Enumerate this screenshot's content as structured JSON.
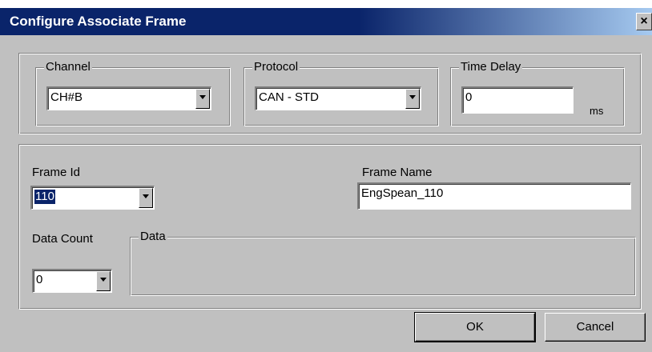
{
  "window": {
    "title": "Configure Associate Frame",
    "close_glyph": "×"
  },
  "channel": {
    "legend": "Channel",
    "value": "CH#B"
  },
  "protocol": {
    "legend": "Protocol",
    "value": "CAN - STD"
  },
  "time_delay": {
    "legend": "Time Delay",
    "value": "0",
    "unit": "ms"
  },
  "frame_id": {
    "label": "Frame Id",
    "value": "110"
  },
  "frame_name": {
    "label": "Frame Name",
    "value": "EngSpean_110"
  },
  "data_count": {
    "label": "Data Count",
    "value": "0"
  },
  "data": {
    "legend": "Data"
  },
  "buttons": {
    "ok": "OK",
    "cancel": "Cancel"
  },
  "colors": {
    "titlebar": "#0a246a",
    "face": "#c0c0c0",
    "selection": "#0a246a"
  }
}
